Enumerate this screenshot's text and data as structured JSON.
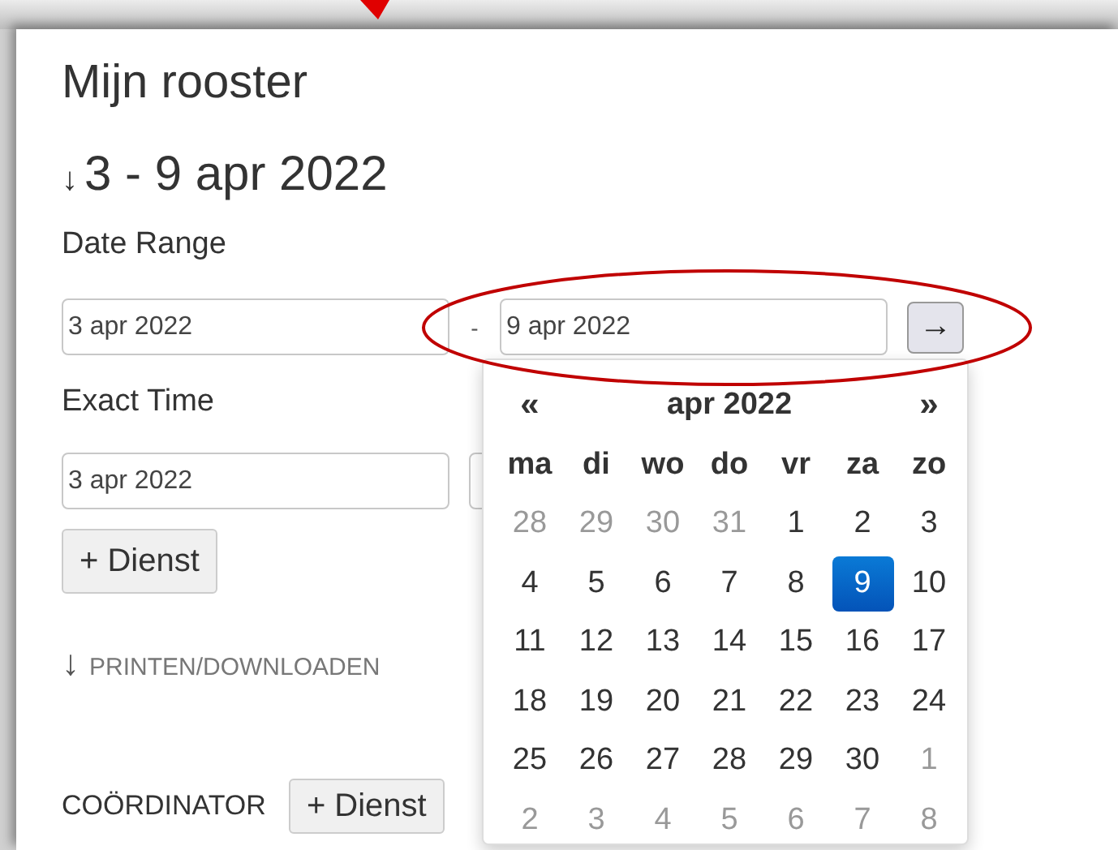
{
  "title": "Mijn rooster",
  "week": {
    "icon": "↓",
    "label": "3 - 9 apr 2022"
  },
  "date_range": {
    "label": "Date Range",
    "from": "3 apr 2022",
    "separator": "-",
    "to": "9 apr 2022",
    "go_button": "→"
  },
  "exact_time": {
    "label": "Exact Time",
    "value": "3 apr 2022"
  },
  "add_button": "+ Dienst",
  "print_link": {
    "icon": "↓",
    "label": "PRINTEN/DOWNLOADEN"
  },
  "coordinator": {
    "label": "COÖRDINATOR",
    "button": "+ Dienst"
  },
  "datepicker": {
    "prev": "«",
    "month": "apr 2022",
    "next": "»",
    "weekdays": [
      "ma",
      "di",
      "wo",
      "do",
      "vr",
      "za",
      "zo"
    ],
    "weeks": [
      [
        {
          "day": "28",
          "muted": true,
          "selected": false
        },
        {
          "day": "29",
          "muted": true,
          "selected": false
        },
        {
          "day": "30",
          "muted": true,
          "selected": false
        },
        {
          "day": "31",
          "muted": true,
          "selected": false
        },
        {
          "day": "1",
          "muted": false,
          "selected": false
        },
        {
          "day": "2",
          "muted": false,
          "selected": false
        },
        {
          "day": "3",
          "muted": false,
          "selected": false
        }
      ],
      [
        {
          "day": "4",
          "muted": false,
          "selected": false
        },
        {
          "day": "5",
          "muted": false,
          "selected": false
        },
        {
          "day": "6",
          "muted": false,
          "selected": false
        },
        {
          "day": "7",
          "muted": false,
          "selected": false
        },
        {
          "day": "8",
          "muted": false,
          "selected": false
        },
        {
          "day": "9",
          "muted": false,
          "selected": true
        },
        {
          "day": "10",
          "muted": false,
          "selected": false
        }
      ],
      [
        {
          "day": "11",
          "muted": false,
          "selected": false
        },
        {
          "day": "12",
          "muted": false,
          "selected": false
        },
        {
          "day": "13",
          "muted": false,
          "selected": false
        },
        {
          "day": "14",
          "muted": false,
          "selected": false
        },
        {
          "day": "15",
          "muted": false,
          "selected": false
        },
        {
          "day": "16",
          "muted": false,
          "selected": false
        },
        {
          "day": "17",
          "muted": false,
          "selected": false
        }
      ],
      [
        {
          "day": "18",
          "muted": false,
          "selected": false
        },
        {
          "day": "19",
          "muted": false,
          "selected": false
        },
        {
          "day": "20",
          "muted": false,
          "selected": false
        },
        {
          "day": "21",
          "muted": false,
          "selected": false
        },
        {
          "day": "22",
          "muted": false,
          "selected": false
        },
        {
          "day": "23",
          "muted": false,
          "selected": false
        },
        {
          "day": "24",
          "muted": false,
          "selected": false
        }
      ],
      [
        {
          "day": "25",
          "muted": false,
          "selected": false
        },
        {
          "day": "26",
          "muted": false,
          "selected": false
        },
        {
          "day": "27",
          "muted": false,
          "selected": false
        },
        {
          "day": "28",
          "muted": false,
          "selected": false
        },
        {
          "day": "29",
          "muted": false,
          "selected": false
        },
        {
          "day": "30",
          "muted": false,
          "selected": false
        },
        {
          "day": "1",
          "muted": true,
          "selected": false
        }
      ],
      [
        {
          "day": "2",
          "muted": true,
          "selected": false
        },
        {
          "day": "3",
          "muted": true,
          "selected": false
        },
        {
          "day": "4",
          "muted": true,
          "selected": false
        },
        {
          "day": "5",
          "muted": true,
          "selected": false
        },
        {
          "day": "6",
          "muted": true,
          "selected": false
        },
        {
          "day": "7",
          "muted": true,
          "selected": false
        },
        {
          "day": "8",
          "muted": true,
          "selected": false
        }
      ]
    ]
  }
}
